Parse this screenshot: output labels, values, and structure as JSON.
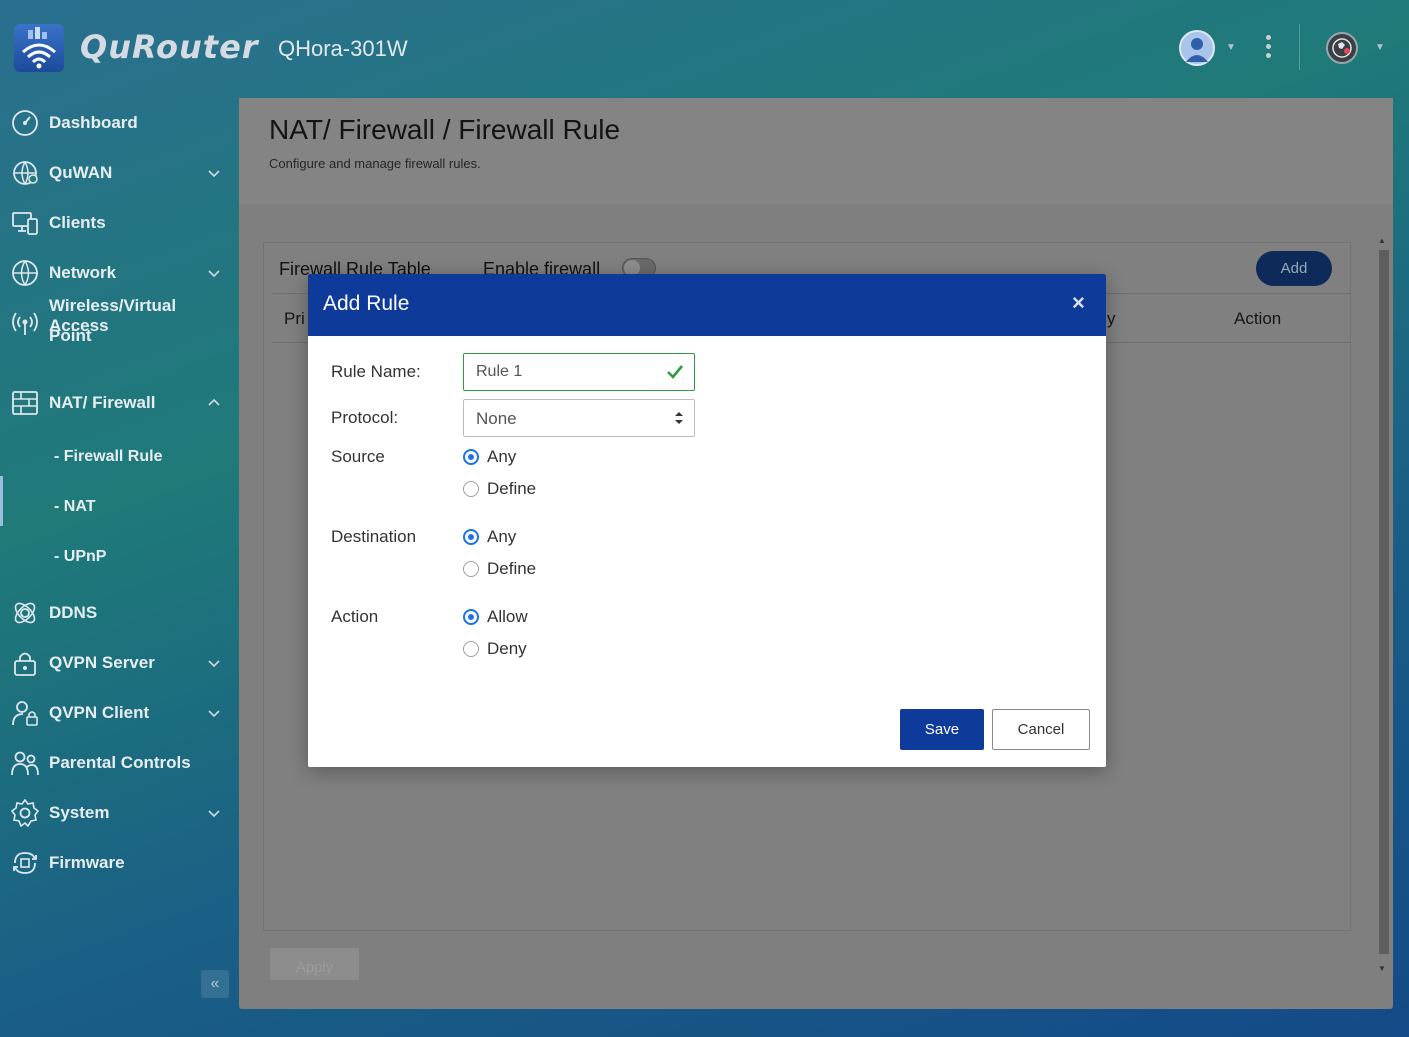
{
  "header": {
    "product_name": "QuRouter",
    "device_name": "QHora-301W"
  },
  "sidebar": {
    "items": [
      {
        "label": "Dashboard",
        "icon": "dashboard-icon"
      },
      {
        "label": "QuWAN",
        "icon": "quwan-icon",
        "expandable": true
      },
      {
        "label": "Clients",
        "icon": "clients-icon"
      },
      {
        "label": "Network",
        "icon": "globe-icon",
        "expandable": true
      },
      {
        "label": "Wireless/Virtual Access",
        "label2": "Point",
        "icon": "wireless-icon"
      },
      {
        "label": "NAT/ Firewall",
        "icon": "firewall-icon",
        "expanded": true
      },
      {
        "label": "DDNS",
        "icon": "ddns-icon"
      },
      {
        "label": "QVPN Server",
        "icon": "lock-icon",
        "expandable": true
      },
      {
        "label": "QVPN Client",
        "icon": "vpn-client-icon",
        "expandable": true
      },
      {
        "label": "Parental Controls",
        "icon": "parental-icon"
      },
      {
        "label": "System",
        "icon": "gear-icon",
        "expandable": true
      },
      {
        "label": "Firmware",
        "icon": "firmware-icon"
      }
    ],
    "subitems": [
      "- Firewall Rule",
      "- NAT",
      "- UPnP"
    ],
    "collapse_glyph": "«"
  },
  "page": {
    "title": "NAT/ Firewall / Firewall Rule",
    "subtitle": "Configure and manage firewall rules.",
    "table_title": "Firewall Rule Table",
    "enable_firewall_label": "Enable firewall",
    "enable_firewall_on": false,
    "add_label": "Add",
    "columns": {
      "priority_partial": "Pri",
      "partial_y": "y",
      "action": "Action"
    },
    "apply_label": "Apply"
  },
  "modal": {
    "title": "Add Rule",
    "close_glyph": "×",
    "rule_name_label": "Rule Name:",
    "rule_name_value": "Rule 1",
    "protocol_label": "Protocol:",
    "protocol_value": "None",
    "source_label": "Source",
    "destination_label": "Destination",
    "action_label": "Action",
    "options": {
      "any": "Any",
      "define": "Define",
      "allow": "Allow",
      "deny": "Deny"
    },
    "selected": {
      "source": "Any",
      "destination": "Any",
      "action": "Allow"
    },
    "save_label": "Save",
    "cancel_label": "Cancel"
  },
  "colors": {
    "primary": "#0e3a9a",
    "radio_selected": "#1a73e8",
    "valid_green": "#2f9a3f"
  }
}
